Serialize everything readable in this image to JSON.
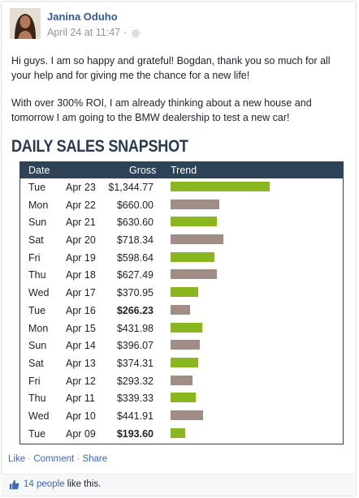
{
  "post": {
    "author": "Janina Oduho",
    "timestamp": "April 24 at 11:47",
    "privacy_icon": "globe-icon",
    "paragraph1": "Hi guys. I am so happy and grateful! Bogdan, thank you so much for all your help and for giving me the chance for a new life!",
    "paragraph2": "With over 300% ROI, I am already thinking about a new house and tomorrow I am going to the BMW dealership to test a new car!"
  },
  "snapshot": {
    "title": "DAILY SALES SNAPSHOT",
    "headers": {
      "date": "Date",
      "gross": "Gross",
      "trend": "Trend"
    },
    "colors": {
      "up": "#8ab71f",
      "down": "#a08d85",
      "header_bg": "#2e4258"
    },
    "rows": [
      {
        "day": "Tue",
        "date": "Apr 23",
        "gross": "$1,344.77",
        "value": 1344.77,
        "trend": "up",
        "bold": false
      },
      {
        "day": "Mon",
        "date": "Apr 22",
        "gross": "$660.00",
        "value": 660.0,
        "trend": "down",
        "bold": false
      },
      {
        "day": "Sun",
        "date": "Apr 21",
        "gross": "$630.60",
        "value": 630.6,
        "trend": "up",
        "bold": false
      },
      {
        "day": "Sat",
        "date": "Apr 20",
        "gross": "$718.34",
        "value": 718.34,
        "trend": "down",
        "bold": false
      },
      {
        "day": "Fri",
        "date": "Apr 19",
        "gross": "$598.64",
        "value": 598.64,
        "trend": "up",
        "bold": false
      },
      {
        "day": "Thu",
        "date": "Apr 18",
        "gross": "$627.49",
        "value": 627.49,
        "trend": "down",
        "bold": false
      },
      {
        "day": "Wed",
        "date": "Apr 17",
        "gross": "$370.95",
        "value": 370.95,
        "trend": "up",
        "bold": false
      },
      {
        "day": "Tue",
        "date": "Apr 16",
        "gross": "$266.23",
        "value": 266.23,
        "trend": "down",
        "bold": true
      },
      {
        "day": "Mon",
        "date": "Apr 15",
        "gross": "$431.98",
        "value": 431.98,
        "trend": "up",
        "bold": false
      },
      {
        "day": "Sun",
        "date": "Apr 14",
        "gross": "$396.07",
        "value": 396.07,
        "trend": "down",
        "bold": false
      },
      {
        "day": "Sat",
        "date": "Apr 13",
        "gross": "$374.31",
        "value": 374.31,
        "trend": "up",
        "bold": false
      },
      {
        "day": "Fri",
        "date": "Apr 12",
        "gross": "$293.32",
        "value": 293.32,
        "trend": "down",
        "bold": false
      },
      {
        "day": "Thu",
        "date": "Apr 11",
        "gross": "$339.33",
        "value": 339.33,
        "trend": "up",
        "bold": false
      },
      {
        "day": "Wed",
        "date": "Apr 10",
        "gross": "$441.91",
        "value": 441.91,
        "trend": "down",
        "bold": false
      },
      {
        "day": "Tue",
        "date": "Apr 09",
        "gross": "$193.60",
        "value": 193.6,
        "trend": "up",
        "bold": true
      }
    ]
  },
  "actions": {
    "like": "Like",
    "comment": "Comment",
    "share": "Share",
    "separator": " · "
  },
  "likes": {
    "icon": "thumbs-up-icon",
    "count": "14 people",
    "suffix": " like this."
  }
}
